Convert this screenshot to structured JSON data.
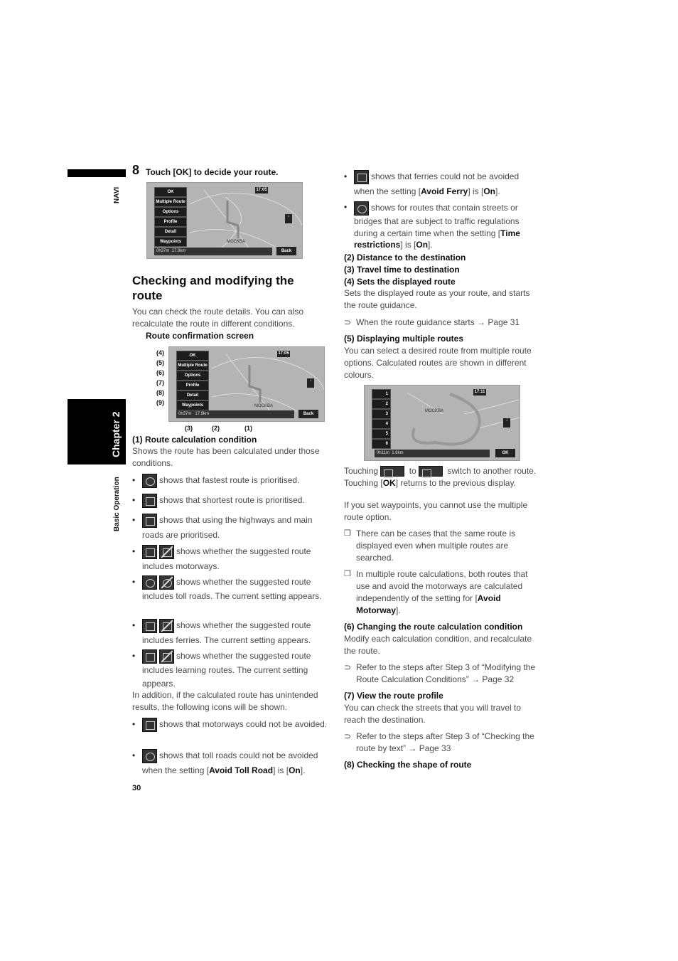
{
  "sidebar": {
    "navi": "NAVI",
    "chapter": "Chapter 2",
    "section": "Basic Operation"
  },
  "step": {
    "number": "8",
    "text": "Touch [OK] to decide your route."
  },
  "screen1": {
    "buttons": [
      "OK",
      "Multiple Route",
      "Options",
      "Profile",
      "Detail",
      "Waypoints"
    ],
    "clock": "17:05",
    "city": "MOCKBA",
    "time": "0h37m",
    "distance": "17.9km",
    "back": "Back"
  },
  "section": {
    "title": "Checking and modifying the route",
    "intro": "You can check the route details. You can also recalculate the route in different conditions.",
    "screen_caption": "Route confirmation screen"
  },
  "screen2": {
    "buttons": [
      "OK",
      "Multiple Route",
      "Options",
      "Profile",
      "Detail",
      "Waypoints"
    ],
    "labels": [
      "(4)",
      "(5)",
      "(6)",
      "(7)",
      "(8)",
      "(9)"
    ],
    "bottom_labels": [
      "(3)",
      "(2)",
      "(1)"
    ],
    "clock": "17:05",
    "city": "MOCKBA",
    "time": "0h37m",
    "distance": "17.9km",
    "back": "Back"
  },
  "left": {
    "h1": "(1) Route calculation condition",
    "p1": "Shows the route has been calculated under those conditions.",
    "bullets": [
      {
        "icon": "fastest-route-icon",
        "text": "shows that fastest route is prioritised."
      },
      {
        "icon": "shortest-route-icon",
        "text": "shows that shortest route is prioritised."
      },
      {
        "icon": "main-roads-icon",
        "text": "shows that using the highways and main roads are prioritised."
      },
      {
        "icon": "motorway-icon",
        "text": "shows whether the suggested route includes motorways."
      },
      {
        "icon": "toll-road-icon",
        "text": "shows whether the suggested route includes toll roads. The current setting appears."
      },
      {
        "icon": "ferry-icon",
        "text": "shows whether the suggested route includes ferries. The current setting  appears."
      },
      {
        "icon": "learning-route-icon",
        "text": "shows whether the suggested route includes learning routes. The current setting appears."
      }
    ],
    "p2": "In addition, if the calculated route has unintended results, the following icons will be shown.",
    "b_motorway": "shows that motorways could not be avoided.",
    "b_toll_pre": "shows that toll roads could not be avoided when the setting [",
    "b_toll_bold": "Avoid Toll Road",
    "b_toll_mid": "] is [",
    "b_toll_on": "On",
    "b_toll_end": "]."
  },
  "page_number": "30",
  "right": {
    "b_ferry_pre": "shows that ferries could not be avoided when the setting [",
    "b_ferry_bold": "Avoid Ferry",
    "b_ferry_mid": "] is [",
    "b_ferry_on": "On",
    "b_ferry_end": "].",
    "b_time_pre": "shows for routes that contain streets or bridges that are subject to traffic regulations during a certain time when the setting [",
    "b_time_bold": "Time restrictions",
    "b_time_mid": "] is [",
    "b_time_on": "On",
    "b_time_end": "].",
    "h2": "(2) Distance to the destination",
    "h3": "(3) Travel time to destination",
    "h4": "(4) Sets the displayed route",
    "p4": "Sets the displayed route as your route, and starts the route guidance.",
    "ref4": "When the route guidance starts → Page 31",
    "h5": "(5) Displaying multiple routes",
    "p5": "You can select a desired route from multiple route options. Calculated routes are shown in different colours.",
    "touch_pre": "Touching",
    "touch_to": "to",
    "touch_post": "switch to another route. Touching [",
    "touch_ok": "OK",
    "touch_end": "] returns to the previous display.",
    "p5b": "If you set waypoints, you cannot use the multiple route option.",
    "note1": "There can be cases that the same route is displayed even when multiple routes are searched.",
    "note2_pre": "In multiple route calculations, both routes that use and avoid the motorways are calculated independently of the setting for [",
    "note2_bold": "Avoid Motorway",
    "note2_end": "].",
    "h6": "(6) Changing the route calculation condition",
    "p6": "Modify each calculation condition, and recalculate the route.",
    "ref6": "Refer to the steps after Step 3 of “Modifying the Route Calculation Conditions” → Page 32",
    "h7": "(7) View the route profile",
    "p7": "You can check the streets that you will travel to reach the destination.",
    "ref7": "Refer to the steps after Step 3 of “Checking the route by text” → Page 33",
    "h8": "(8) Checking the shape of route"
  },
  "screen3": {
    "buttons": [
      "1",
      "2",
      "3",
      "4",
      "5",
      "6"
    ],
    "clock": "17:11",
    "city": "MOCKBA",
    "time": "0h11m",
    "distance": "1.8km",
    "ok": "OK"
  },
  "icons": {
    "ref_arrow": "⊃",
    "note_box": "❒",
    "bullet": "•"
  }
}
